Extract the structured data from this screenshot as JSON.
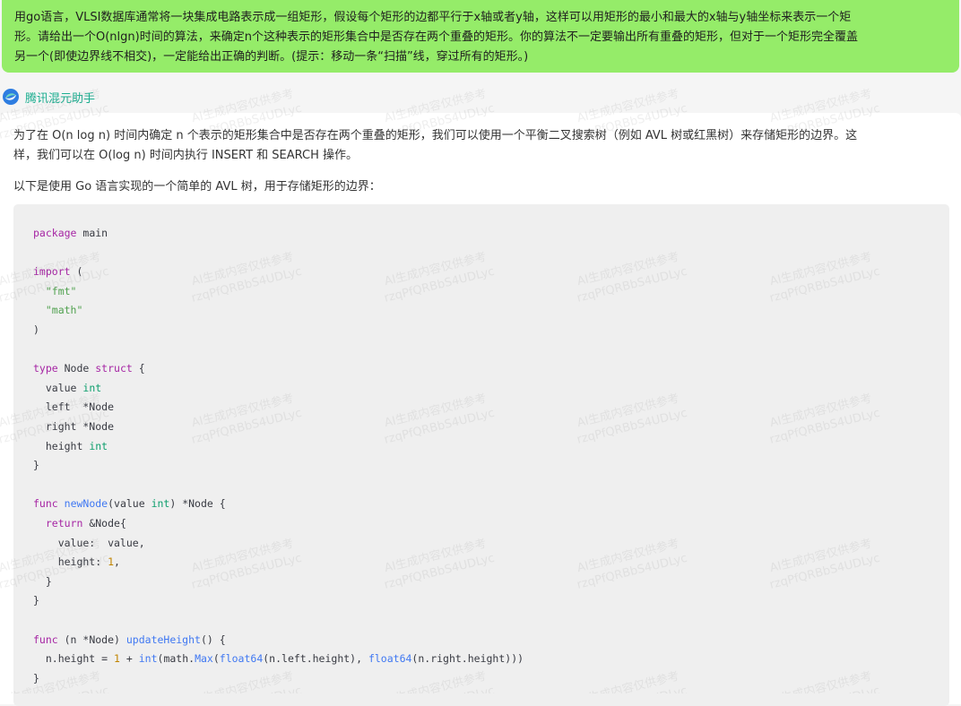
{
  "user_message": {
    "line1": "用go语言，VLSI数据库通常将一块集成电路表示成一组矩形，假设每个矩形的边都平行于x轴或者y轴，这样可以用矩形的最小和最大的x轴与y轴坐标来表示一个矩",
    "line2": "形。请给出一个O(nlgn)时间的算法，来确定n个这种表示的矩形集合中是否存在两个重叠的矩形。你的算法不一定要输出所有重叠的矩形，但对于一个矩形完全覆盖",
    "line3": "另一个(即使边界线不相交)，一定能给出正确的判断。(提示：移动一条“扫描”线，穿过所有的矩形。)"
  },
  "assistant": {
    "name": "腾讯混元助手",
    "avatar_icon": "hunyuan-logo-icon",
    "paragraph1_line1": "为了在 O(n log n) 时间内确定 n 个表示的矩形集合中是否存在两个重叠的矩形，我们可以使用一个平衡二叉搜索树（例如 AVL 树或红黑树）来存储矩形的边界。这",
    "paragraph1_line2": "样，我们可以在 O(log n) 时间内执行 INSERT 和 SEARCH 操作。",
    "paragraph2": "以下是使用 Go 语言实现的一个简单的 AVL 树，用于存储矩形的边界："
  },
  "watermark": {
    "line1": "AI生成内容仅供参考",
    "line2": "rzqPfQRBbS4UDLyc"
  },
  "code_lines": [
    [
      [
        "kw",
        "package"
      ],
      [
        "p",
        " main"
      ]
    ],
    [],
    [
      [
        "kw",
        "import"
      ],
      [
        "p",
        " ("
      ]
    ],
    [
      [
        "p",
        "  "
      ],
      [
        "str",
        "\"fmt\""
      ]
    ],
    [
      [
        "p",
        "  "
      ],
      [
        "str",
        "\"math\""
      ]
    ],
    [
      [
        "p",
        ")"
      ]
    ],
    [],
    [
      [
        "kw",
        "type"
      ],
      [
        "p",
        " Node "
      ],
      [
        "kw",
        "struct"
      ],
      [
        "p",
        " {"
      ]
    ],
    [
      [
        "p",
        "  value "
      ],
      [
        "type",
        "int"
      ]
    ],
    [
      [
        "p",
        "  left  *Node"
      ]
    ],
    [
      [
        "p",
        "  right *Node"
      ]
    ],
    [
      [
        "p",
        "  height "
      ],
      [
        "type",
        "int"
      ]
    ],
    [
      [
        "p",
        "}"
      ]
    ],
    [],
    [
      [
        "kw",
        "func"
      ],
      [
        "p",
        " "
      ],
      [
        "fn",
        "newNode"
      ],
      [
        "p",
        "(value "
      ],
      [
        "type",
        "int"
      ],
      [
        "p",
        ") *Node {"
      ]
    ],
    [
      [
        "p",
        "  "
      ],
      [
        "kw",
        "return"
      ],
      [
        "p",
        " &Node{"
      ]
    ],
    [
      [
        "p",
        "    value:  value,"
      ]
    ],
    [
      [
        "p",
        "    height: "
      ],
      [
        "num",
        "1"
      ],
      [
        "p",
        ","
      ]
    ],
    [
      [
        "p",
        "  }"
      ]
    ],
    [
      [
        "p",
        "}"
      ]
    ],
    [],
    [
      [
        "kw",
        "func"
      ],
      [
        "p",
        " (n *Node) "
      ],
      [
        "fn",
        "updateHeight"
      ],
      [
        "p",
        "() {"
      ]
    ],
    [
      [
        "p",
        "  n.height = "
      ],
      [
        "num",
        "1"
      ],
      [
        "p",
        " + "
      ],
      [
        "bi",
        "int"
      ],
      [
        "p",
        "(math."
      ],
      [
        "fn",
        "Max"
      ],
      [
        "p",
        "("
      ],
      [
        "bi",
        "float64"
      ],
      [
        "p",
        "(n.left.height), "
      ],
      [
        "bi",
        "float64"
      ],
      [
        "p",
        "(n.right.height)))"
      ]
    ],
    [
      [
        "p",
        "}"
      ]
    ]
  ]
}
